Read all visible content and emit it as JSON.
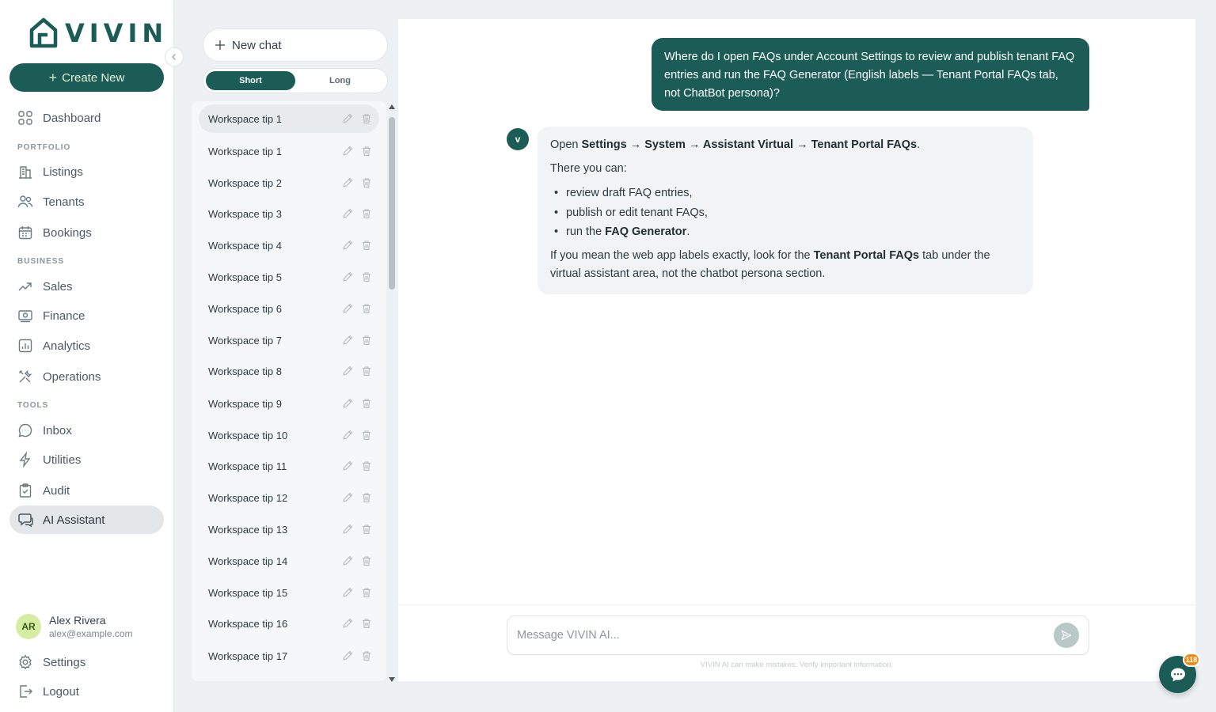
{
  "brand": {
    "name": "VIVIN",
    "color": "#1b5c57"
  },
  "nav": {
    "create_label": "Create New",
    "items": [
      {
        "label": "Dashboard",
        "icon": "grid-icon"
      },
      {
        "label": "Listings",
        "icon": "buildings-icon"
      },
      {
        "label": "Tenants",
        "icon": "users-icon"
      },
      {
        "label": "Bookings",
        "icon": "calendar-icon"
      },
      {
        "label": "Sales",
        "icon": "trending-up-icon"
      },
      {
        "label": "Finance",
        "icon": "banknote-icon"
      },
      {
        "label": "Analytics",
        "icon": "bar-chart-icon"
      },
      {
        "label": "Operations",
        "icon": "tools-icon"
      },
      {
        "label": "Inbox",
        "icon": "message-circle-icon"
      },
      {
        "label": "Utilities",
        "icon": "zap-icon"
      },
      {
        "label": "Audit",
        "icon": "clipboard-icon"
      },
      {
        "label": "AI Assistant",
        "icon": "chat-bubbles-icon",
        "active": true
      }
    ],
    "sections": {
      "portfolio": "PORTFOLIO",
      "business": "BUSINESS",
      "tools": "TOOLS"
    },
    "user": {
      "initials": "AR",
      "name": "Alex Rivera",
      "email": "alex@example.com"
    },
    "settings_label": "Settings",
    "logout_label": "Logout"
  },
  "chat_list": {
    "new_chat_label": "New chat",
    "modes": [
      "Short",
      "Long"
    ],
    "active_mode": "Short",
    "items": [
      "Workspace tip 1",
      "Workspace tip 1",
      "Workspace tip 2",
      "Workspace tip 3",
      "Workspace tip 4",
      "Workspace tip 5",
      "Workspace tip 6",
      "Workspace tip 7",
      "Workspace tip 8",
      "Workspace tip 9",
      "Workspace tip 10",
      "Workspace tip 11",
      "Workspace tip 12",
      "Workspace tip 13",
      "Workspace tip 14",
      "Workspace tip 15",
      "Workspace tip 16",
      "Workspace tip 17"
    ],
    "selected_index": 0
  },
  "conversation": {
    "user_message": "Where do I open FAQs under Account Settings to review and publish tenant FAQ entries and run the FAQ Generator (English labels — Tenant Portal FAQs tab, not ChatBot persona)?",
    "bot_avatar": "v",
    "bot": {
      "open_prefix": "Open ",
      "path": [
        "Settings",
        "System",
        "Assistant Virtual",
        "Tenant Portal FAQs"
      ],
      "path_sep": " → ",
      "open_suffix": ".",
      "intro": "There you can:",
      "bullets": {
        "b1": "review draft FAQ entries,",
        "b2": "publish or edit tenant FAQs,",
        "b3_prefix": "run the ",
        "b3_bold": "FAQ Generator",
        "b3_suffix": "."
      },
      "outro_prefix": "If you mean the web app labels exactly, look for the ",
      "outro_bold": "Tenant Portal FAQs",
      "outro_suffix": " tab under the virtual assistant area, not the chatbot persona section."
    },
    "input_placeholder": "Message VIVIN AI...",
    "disclaimer": "VIVIN AI can make mistakes. Verify important information."
  },
  "widget": {
    "badge": "118",
    "icon": "chat-bubble-icon",
    "badge_color": "#f08c18"
  }
}
